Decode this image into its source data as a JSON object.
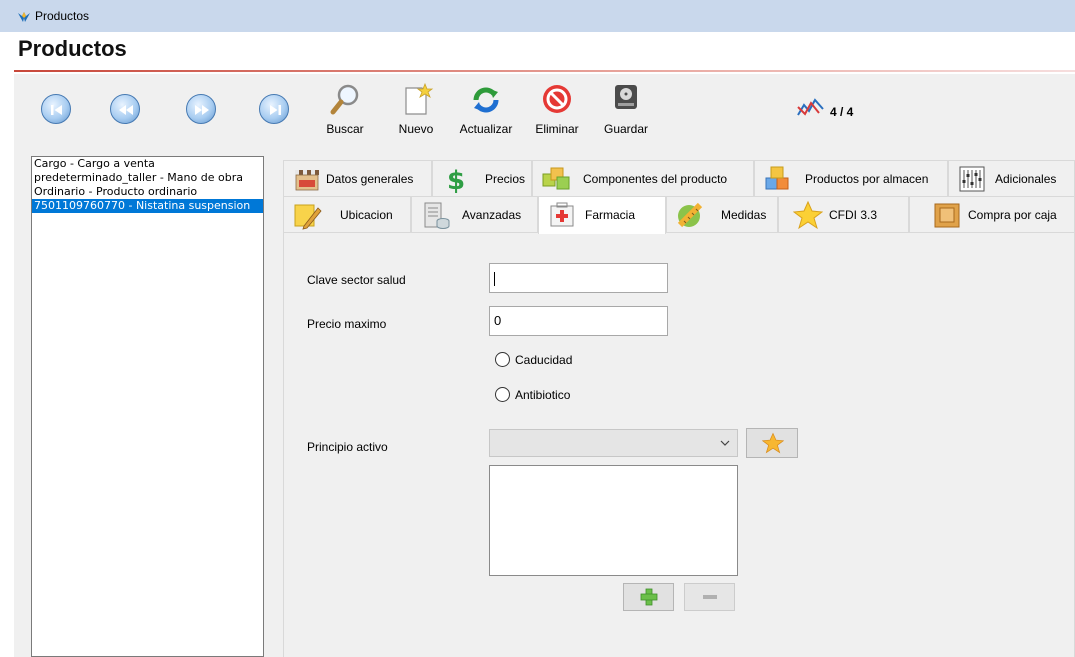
{
  "window": {
    "title": "Productos",
    "heading": "Productos"
  },
  "toolbar": {
    "first_icon": "skip-first-icon",
    "prev_icon": "rewind-icon",
    "next_icon": "fast-forward-icon",
    "last_icon": "skip-last-icon",
    "buscar": "Buscar",
    "nuevo": "Nuevo",
    "actualizar": "Actualizar",
    "eliminar": "Eliminar",
    "guardar": "Guardar"
  },
  "record_counter": "4 / 4",
  "product_list": [
    {
      "label": "Cargo - Cargo a venta",
      "selected": false
    },
    {
      "label": "predeterminado_taller - Mano de obra",
      "selected": false
    },
    {
      "label": "Ordinario - Producto ordinario",
      "selected": false
    },
    {
      "label": "7501109760770 - Nistatina suspension",
      "selected": true
    }
  ],
  "tabs": {
    "row1": [
      {
        "label": "Datos generales",
        "icon": "store-icon"
      },
      {
        "label": "Precios",
        "icon": "dollar-icon"
      },
      {
        "label": "Componentes del producto",
        "icon": "cubes-icon"
      },
      {
        "label": "Productos por almacen",
        "icon": "boxes-icon"
      },
      {
        "label": "Adicionales",
        "icon": "sliders-icon"
      }
    ],
    "row2": [
      {
        "label": "Ubicacion",
        "icon": "note-pencil-icon"
      },
      {
        "label": "Avanzadas",
        "icon": "server-icon"
      },
      {
        "label": "Farmacia",
        "icon": "first-aid-icon",
        "active": true
      },
      {
        "label": "Medidas",
        "icon": "measure-icon"
      },
      {
        "label": "CFDI 3.3",
        "icon": "star-icon"
      },
      {
        "label": "Compra por caja",
        "icon": "box-icon"
      }
    ]
  },
  "farmacia": {
    "clave_label": "Clave sector salud",
    "clave_value": "",
    "precio_label": "Precio maximo",
    "precio_value": "0",
    "caducidad_label": "Caducidad",
    "caducidad_checked": false,
    "antibiotico_label": "Antibiotico",
    "antibiotico_checked": false,
    "principio_label": "Principio activo",
    "principio_value": "",
    "principio_items": []
  },
  "colors": {
    "titlebar": "#c9d8ec",
    "selection": "#0078d7",
    "accent_line": "#c8473a",
    "panel": "#f0f0f0"
  }
}
